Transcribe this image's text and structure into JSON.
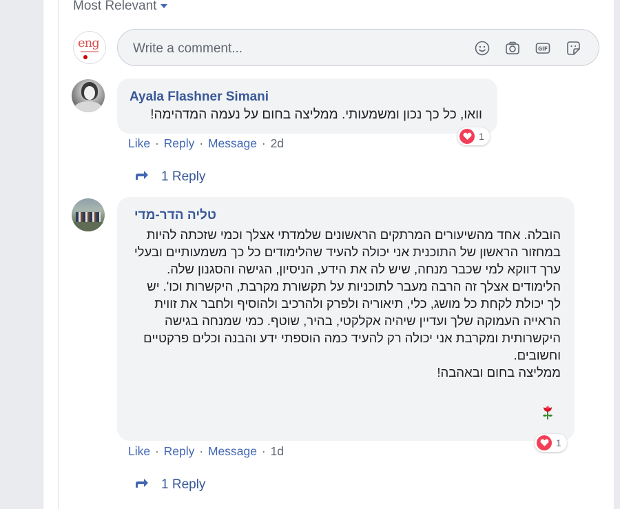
{
  "sort": {
    "label": "Most Relevant"
  },
  "composer": {
    "placeholder": "Write a comment...",
    "avatar_logo": "eng",
    "icons": [
      "emoji-icon",
      "camera-icon",
      "gif-icon",
      "sticker-icon"
    ]
  },
  "comments": [
    {
      "author": "Ayala Flashner Simani",
      "text": "וואו, כל כך נכון ומשמעותי. ממליצה בחום על נעמה המדהימה!",
      "reaction_count": "1",
      "actions": {
        "like": "Like",
        "reply": "Reply",
        "message": "Message",
        "time": "2d"
      },
      "replies_label": "1 Reply"
    },
    {
      "author": "טליה הדר-מדי",
      "text_lines": [
        "הובלה. אחד מהשיעורים המרתקים הראשונים שלמדתי אצלך וכמי שזכתה להיות במחזור הראשון של התוכנית אני יכולה להעיד שהלימודים כל כך משמעותיים ובעלי ערך דווקא למי שכבר מנחה, שיש לה את הידע, הניסיון, הגישה והסגנון שלה.",
        "הלימודים אצלך זה הרבה מעבר לתוכניות על תקשורת מקרבת, היקשרות וכו'. יש לך יכולת לקחת כל מושג, כלי, תיאוריה ולפרק ולהרכיב ולהוסיף ולחבר את זווית הראייה העמוקה שלך ועדיין שיהיה אקלקטי, בהיר, שוטף. כמי שמנחה בגישה היקשרותית ומקרבת אני יכולה רק להעיד כמה הוספתי ידע והבנה וכלים פרקטיים וחשובים.",
        "ממליצה בחום ובאהבה!"
      ],
      "reaction_count": "1",
      "actions": {
        "like": "Like",
        "reply": "Reply",
        "message": "Message",
        "time": "1d"
      },
      "replies_label": "1 Reply"
    }
  ],
  "colors": {
    "link": "#385898",
    "action": "#4267b2",
    "bubble": "#f2f3f5",
    "love": "#f33e58",
    "gutter": "#e9ebee"
  }
}
